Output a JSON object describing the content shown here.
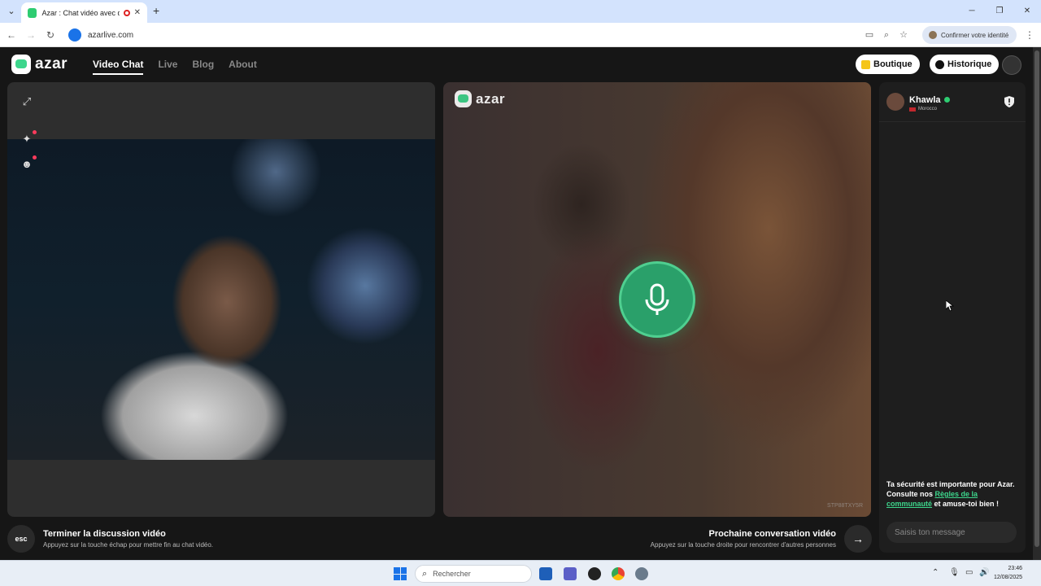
{
  "browser": {
    "tab_title": "Azar : Chat vidéo avec de n",
    "new_tab": "+",
    "url": "azarlive.com",
    "confirm_identity": "Confirmer votre identité"
  },
  "app": {
    "logo": "azar",
    "nav": [
      "Video Chat",
      "Live",
      "Blog",
      "About"
    ],
    "boutique_label": "Boutique",
    "historique_label": "Historique",
    "accent_color": "#3dd68c"
  },
  "peer": {
    "name": "Khawla",
    "country": "Morocco"
  },
  "remote": {
    "logo": "azar",
    "watermark": "STP88TXY5R"
  },
  "chat": {
    "safety_part1": "Ta sécurité est importante pour Azar. Consulte nos ",
    "safety_link": "Règles de la communauté",
    "safety_part2": " et amuse-toi bien !",
    "input_placeholder": "Saisis ton message"
  },
  "bottom": {
    "esc_key": "esc",
    "end_title": "Terminer la discussion vidéo",
    "end_sub": "Appuyez sur la touche échap pour mettre fin au chat vidéo.",
    "next_title": "Prochaine conversation vidéo",
    "next_sub": "Appuyez sur la touche droite pour rencontrer d'autres personnes"
  },
  "taskbar": {
    "search_placeholder": "Rechercher",
    "time": "23:46",
    "date": "12/08/2025"
  }
}
